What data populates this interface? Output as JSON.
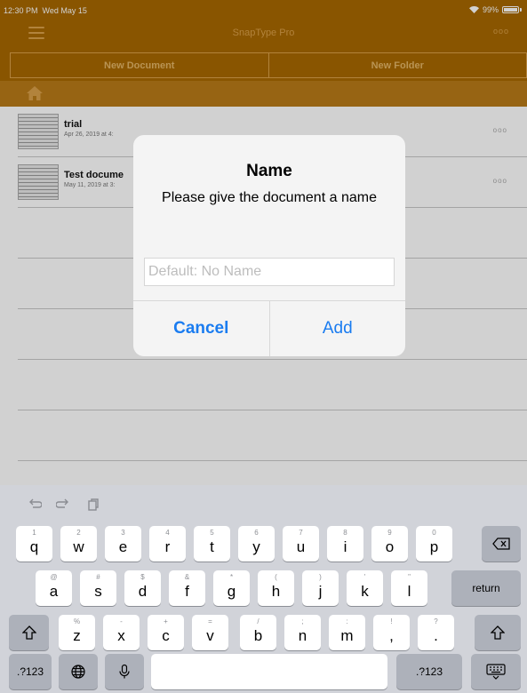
{
  "status_bar": {
    "time": "12:30 PM",
    "date": "Wed May 15",
    "battery": "99%"
  },
  "navbar": {
    "title": "SnapType Pro",
    "more_label": "ooo"
  },
  "segments": [
    {
      "label": "New Document"
    },
    {
      "label": "New Folder"
    }
  ],
  "documents": [
    {
      "name": "trial",
      "date": "Apr 26, 2019 at 4:",
      "more": "ooo"
    },
    {
      "name": "Test docume",
      "date": "May 11, 2019 at 3:",
      "more": "ooo"
    }
  ],
  "dialog": {
    "title": "Name",
    "message": "Please give the document a name",
    "input_placeholder": "Default: No Name",
    "input_value": "",
    "cancel_label": "Cancel",
    "add_label": "Add"
  },
  "keyboard": {
    "toolbar": [
      "undo-icon",
      "redo-icon",
      "paste-icon"
    ],
    "row1": [
      {
        "main": "q",
        "alt": "1"
      },
      {
        "main": "w",
        "alt": "2"
      },
      {
        "main": "e",
        "alt": "3"
      },
      {
        "main": "r",
        "alt": "4"
      },
      {
        "main": "t",
        "alt": "5"
      },
      {
        "main": "y",
        "alt": "6"
      },
      {
        "main": "u",
        "alt": "7"
      },
      {
        "main": "i",
        "alt": "8"
      },
      {
        "main": "o",
        "alt": "9"
      },
      {
        "main": "p",
        "alt": "0"
      }
    ],
    "row2": [
      {
        "main": "a",
        "alt": "@"
      },
      {
        "main": "s",
        "alt": "#"
      },
      {
        "main": "d",
        "alt": "$"
      },
      {
        "main": "f",
        "alt": "&"
      },
      {
        "main": "g",
        "alt": "*"
      },
      {
        "main": "h",
        "alt": "("
      },
      {
        "main": "j",
        "alt": ")"
      },
      {
        "main": "k",
        "alt": "'"
      },
      {
        "main": "l",
        "alt": "\""
      }
    ],
    "row3": [
      {
        "main": "z",
        "alt": "%"
      },
      {
        "main": "x",
        "alt": "-"
      },
      {
        "main": "c",
        "alt": "+"
      },
      {
        "main": "v",
        "alt": "="
      },
      {
        "main": "b",
        "alt": "/"
      },
      {
        "main": "n",
        "alt": ";"
      },
      {
        "main": "m",
        "alt": ":"
      },
      {
        "main": ",",
        "alt": "!"
      },
      {
        "main": ".",
        "alt": "?"
      }
    ],
    "return_label": "return",
    "numbers_label": ".?123"
  },
  "colors": {
    "chrome": "#a86800",
    "accent_text": "#d9a04a",
    "dialog_button": "#1a7cf0"
  }
}
